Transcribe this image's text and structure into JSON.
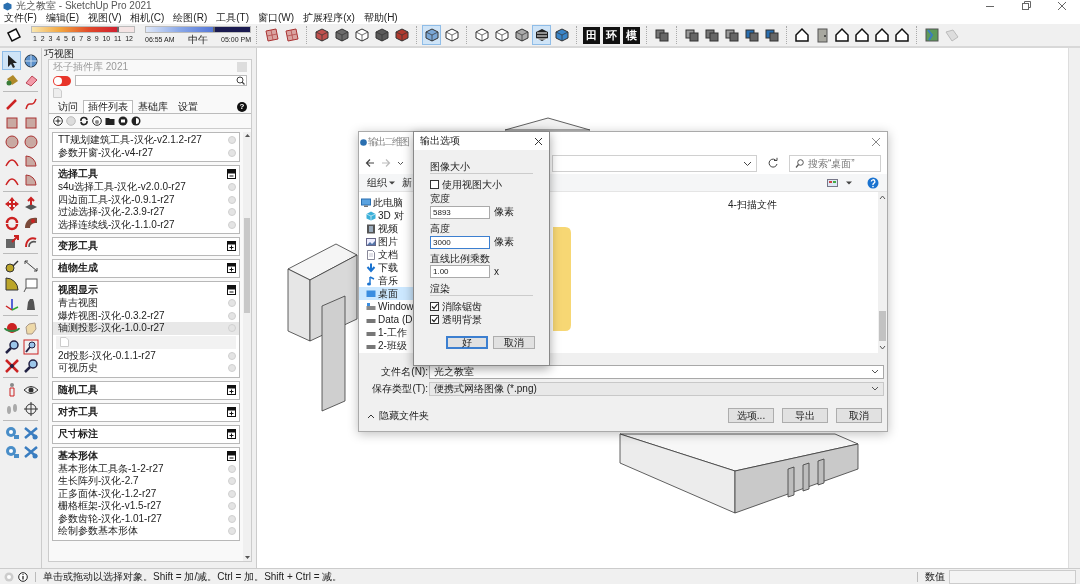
{
  "window": {
    "title": "光之教室 - SketchUp Pro 2021"
  },
  "menu": [
    "文件(F)",
    "编辑(E)",
    "视图(V)",
    "相机(C)",
    "绘图(R)",
    "工具(T)",
    "窗口(W)",
    "扩展程序(x)",
    "帮助(H)"
  ],
  "toolbar": {
    "leading_buttons": [
      {
        "selected": false
      }
    ],
    "month_slider": {
      "labels": [
        "1",
        "2",
        "3",
        "4",
        "5",
        "6",
        "7",
        "8",
        "9",
        "10",
        "11",
        "12"
      ],
      "level": 0.85
    },
    "time_slider": {
      "start": "06:55 AM",
      "middle": "中午",
      "end": "05:00 PM",
      "level": 0.66
    },
    "groups": [
      {
        "buttons": [
          {
            "selected": false
          },
          {
            "selected": false
          }
        ]
      },
      {
        "buttons": [
          {
            "selected": false
          },
          {
            "selected": false
          },
          {
            "selected": false
          },
          {
            "selected": false
          },
          {
            "selected": false
          }
        ]
      },
      {
        "buttons": [
          {
            "selected": true
          },
          {
            "selected": false
          }
        ]
      },
      {
        "buttons": [
          {
            "selected": false
          },
          {
            "selected": false
          },
          {
            "selected": false
          },
          {
            "selected": true
          },
          {
            "selected": false
          }
        ]
      },
      {
        "buttons": [
          {
            "label": "田",
            "selected": false
          },
          {
            "label": "环",
            "selected": false
          },
          {
            "label": "模",
            "selected": false
          }
        ]
      },
      {
        "buttons": [
          {
            "selected": false
          }
        ]
      },
      {
        "buttons": [
          {
            "selected": false
          },
          {
            "selected": false
          },
          {
            "selected": false
          },
          {
            "selected": false
          },
          {
            "selected": false
          }
        ]
      },
      {
        "buttons": [
          {
            "selected": false
          },
          {
            "selected": false
          },
          {
            "selected": false
          },
          {
            "selected": false
          },
          {
            "selected": false
          },
          {
            "selected": false
          }
        ]
      },
      {
        "buttons": [
          {
            "selected": false
          },
          {
            "selected": false
          }
        ]
      }
    ]
  },
  "tool_palette": {
    "groups": [
      {
        "tools": [
          {
            "selected": true
          },
          {
            "selected": false
          },
          {
            "selected": false
          },
          {
            "selected": false
          }
        ]
      },
      {
        "tools": [
          {
            "selected": false
          },
          {
            "selected": false
          },
          {
            "selected": false
          },
          {
            "selected": false
          },
          {
            "selected": false
          },
          {
            "selected": false
          },
          {
            "selected": false
          },
          {
            "selected": false
          },
          {
            "selected": false
          },
          {
            "selected": false
          }
        ]
      },
      {
        "tools": [
          {
            "selected": false
          },
          {
            "selected": false
          },
          {
            "selected": false
          },
          {
            "selected": false
          },
          {
            "selected": false
          },
          {
            "selected": false
          }
        ]
      },
      {
        "tools": [
          {
            "selected": false
          },
          {
            "selected": false
          },
          {
            "selected": false
          },
          {
            "selected": false
          },
          {
            "selected": false
          },
          {
            "selected": false
          }
        ]
      },
      {
        "tools": [
          {
            "selected": false
          },
          {
            "selected": false
          },
          {
            "selected": false
          },
          {
            "selected": false
          },
          {
            "selected": false
          },
          {
            "selected": false
          }
        ]
      },
      {
        "tools": [
          {
            "selected": false
          },
          {
            "selected": false
          },
          {
            "selected": false
          },
          {
            "selected": false
          }
        ]
      },
      {
        "tools": [
          {
            "selected": false
          },
          {
            "selected": false
          },
          {
            "selected": false
          },
          {
            "selected": false
          }
        ]
      }
    ]
  },
  "side_panel": {
    "label": "巧视图",
    "plugin_library": {
      "title": "坯子插件库 2021",
      "toggle": {
        "on": false
      },
      "tabs": [
        {
          "label": "访问",
          "selected": false
        },
        {
          "label": "插件列表",
          "selected": true
        },
        {
          "label": "基础库",
          "selected": false
        },
        {
          "label": "设置",
          "selected": false
        }
      ],
      "help": "?",
      "groups": [
        {
          "items": [
            {
              "kind": "plugin",
              "label": "TT规划建筑工具-汉化-v2.1.2-r27",
              "selected": false
            },
            {
              "kind": "plugin",
              "label": "参数开窗-汉化-v4-r27",
              "selected": false
            }
          ]
        },
        {
          "title": "选择工具",
          "expanded": true,
          "items": [
            {
              "kind": "plugin",
              "label": "s4u选择工具-汉化-v2.0.0-r27",
              "selected": false
            },
            {
              "kind": "plugin",
              "label": "四边面工具-汉化-0.9.1-r27",
              "selected": false
            },
            {
              "kind": "plugin",
              "label": "过滤选择-汉化-2.3.9-r27",
              "selected": false
            },
            {
              "kind": "plugin",
              "label": "选择连续线-汉化-1.1.0-r27",
              "selected": false
            }
          ]
        },
        {
          "title": "变形工具",
          "expanded": false
        },
        {
          "title": "植物生成",
          "expanded": false
        },
        {
          "title": "视图显示",
          "expanded": true,
          "items": [
            {
              "kind": "plugin",
              "label": "青吉视图",
              "selected": false
            },
            {
              "kind": "plugin",
              "label": "爆炸视图-汉化-0.3.2-r27",
              "selected": false
            },
            {
              "kind": "plugin",
              "label": "轴测投影-汉化-1.0.0-r27",
              "selected": true
            },
            {
              "kind": "preview"
            },
            {
              "kind": "plugin",
              "label": "2d投影-汉化-0.1.1-r27",
              "selected": false
            },
            {
              "kind": "plugin",
              "label": "可视历史",
              "selected": false
            }
          ]
        },
        {
          "title": "随机工具",
          "expanded": false
        },
        {
          "title": "对齐工具",
          "expanded": false
        },
        {
          "title": "尺寸标注",
          "expanded": false
        },
        {
          "title": "基本形体",
          "expanded": true,
          "items": [
            {
              "kind": "plugin",
              "label": "基本形体工具条-1-2-r27",
              "selected": false
            },
            {
              "kind": "plugin",
              "label": "生长阵列-汉化-2.7",
              "selected": false
            },
            {
              "kind": "plugin",
              "label": "正多面体-汉化-1.2-r27",
              "selected": false
            },
            {
              "kind": "plugin",
              "label": "栅格框架-汉化-v1.5-r27",
              "selected": false
            },
            {
              "kind": "plugin",
              "label": "参数齿轮-汉化-1.01-r27",
              "selected": false
            },
            {
              "kind": "plugin",
              "label": "绘制参数基本形体",
              "selected": false
            }
          ]
        }
      ]
    }
  },
  "export_dialog": {
    "title": "输出二维图",
    "search": {
      "placeholder": "搜索“桌面”"
    },
    "toolbar": {
      "organize": "组织",
      "new": "新"
    },
    "nav": [
      {
        "label": "此电脑",
        "selected": false,
        "children": [
          {
            "label": "3D 对",
            "selected": false
          },
          {
            "label": "视频",
            "selected": false
          },
          {
            "label": "图片",
            "selected": false
          },
          {
            "label": "文档",
            "selected": false
          },
          {
            "label": "下载",
            "selected": false
          },
          {
            "label": "音乐",
            "selected": false
          },
          {
            "label": "桌面",
            "selected": true
          },
          {
            "label": "Window",
            "selected": false
          },
          {
            "label": "Data (D",
            "selected": false
          },
          {
            "label": "1-工作",
            "selected": false
          },
          {
            "label": "2-班级",
            "selected": false
          }
        ]
      }
    ],
    "files": [
      {
        "label": "4-扫描文件"
      }
    ],
    "file_name": {
      "label": "文件名(N):",
      "value": "光之教室"
    },
    "file_type": {
      "label": "保存类型(T):",
      "value": "便携式网络图像 (*.png)"
    },
    "hide_folders": "隐藏文件夹",
    "buttons": [
      "选项...",
      "导出",
      "取消"
    ]
  },
  "options_dialog": {
    "title": "输出选项",
    "sections": [
      {
        "heading": "图像大小",
        "rows": [
          {
            "kind": "checkbox",
            "label": "使用视图大小",
            "checked": false
          },
          {
            "kind": "number",
            "label": "宽度",
            "value": "5893",
            "unit": "像素",
            "focused": false
          },
          {
            "kind": "number",
            "label": "高度",
            "value": "3000",
            "unit": "像素",
            "focused": true
          },
          {
            "kind": "number",
            "label": "直线比例乘数",
            "value": "1.00",
            "unit": "x",
            "focused": false
          }
        ]
      },
      {
        "heading": "渲染",
        "rows": [
          {
            "kind": "checkbox",
            "label": "消除锯齿",
            "checked": true
          },
          {
            "kind": "checkbox",
            "label": "透明背景",
            "checked": true
          }
        ]
      }
    ],
    "buttons": [
      {
        "label": "好",
        "default": true
      },
      {
        "label": "取消",
        "default": false
      }
    ]
  },
  "status_bar": {
    "message": "单击或拖动以选择对象。Shift = 加/减。Ctrl = 加。Shift + Ctrl = 减。",
    "measurements_label": "数值"
  }
}
